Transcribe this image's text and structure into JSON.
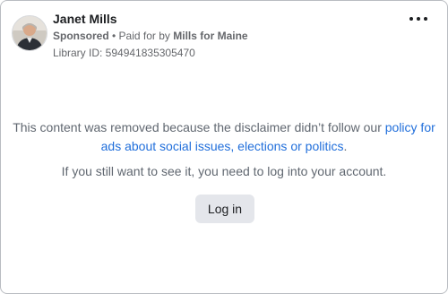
{
  "advertiser": {
    "name": "Janet Mills",
    "sponsored_label": "Sponsored",
    "paid_for_prefix": " • Paid for by ",
    "paid_for_name": "Mills for Maine",
    "library_id": "Library ID: 594941835305470"
  },
  "menu": {
    "icon": "more-horizontal-icon"
  },
  "notice": {
    "text_before_link": "This content was removed because the disclaimer didn’t follow our ",
    "link_text": "policy for ads about social issues, elections or politics",
    "text_after_link": ".",
    "login_hint": "If you still want to see it, you need to log into your account.",
    "login_button": "Log in"
  },
  "colors": {
    "link": "#216fdb",
    "muted_text": "#65676b",
    "button_bg": "#e4e6eb",
    "border": "#b9bcc1"
  }
}
